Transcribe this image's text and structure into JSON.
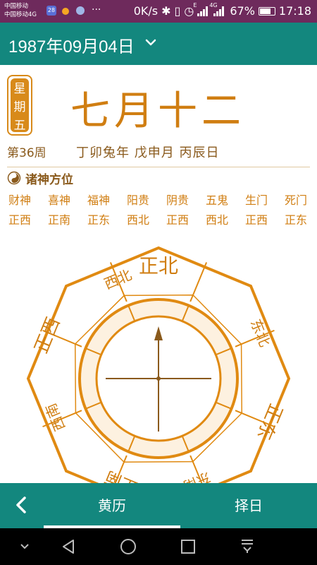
{
  "status_bar": {
    "carrier_1": "中国移动",
    "carrier_2": "中国移动4G",
    "badge": "28",
    "more": "···",
    "speed": "0K/s",
    "battery": "67%",
    "battery_level": 0.67,
    "time": "17:18",
    "net_label_1": "E",
    "net_label_2": "4G"
  },
  "header": {
    "date": "1987年09月04日"
  },
  "day": {
    "weekday_chars": [
      "星",
      "期",
      "五"
    ],
    "lunar_date": "七月十二",
    "week_number": "第36周",
    "ganzhi": "丁卯兔年  戊申月  丙辰日"
  },
  "gods_section": {
    "title": "诸神方位",
    "items": [
      {
        "name": "财神",
        "direction": "正西"
      },
      {
        "name": "喜神",
        "direction": "正南"
      },
      {
        "name": "福神",
        "direction": "正东"
      },
      {
        "name": "阳贵",
        "direction": "西北"
      },
      {
        "name": "阴贵",
        "direction": "正西"
      },
      {
        "name": "五鬼",
        "direction": "西北"
      },
      {
        "name": "生门",
        "direction": "正西"
      },
      {
        "name": "死门",
        "direction": "正东"
      }
    ]
  },
  "compass": {
    "directions": {
      "north": "正北",
      "northwest": "西北",
      "northeast": "东北",
      "west": "正西",
      "east": "正东",
      "southwest": "西南",
      "southeast": "东南",
      "south": "正南"
    },
    "colors": {
      "ring": "#e08a12",
      "fill": "#fdf1e0",
      "needle": "#8a5a1c"
    }
  },
  "tabbar": {
    "tabs": [
      "黄历",
      "择日"
    ],
    "active_tab": "黄历"
  },
  "colors": {
    "status_bar": "#6e2a5c",
    "primary": "#13877e",
    "accent": "#d07e12",
    "text_brown": "#8a5a1c"
  }
}
